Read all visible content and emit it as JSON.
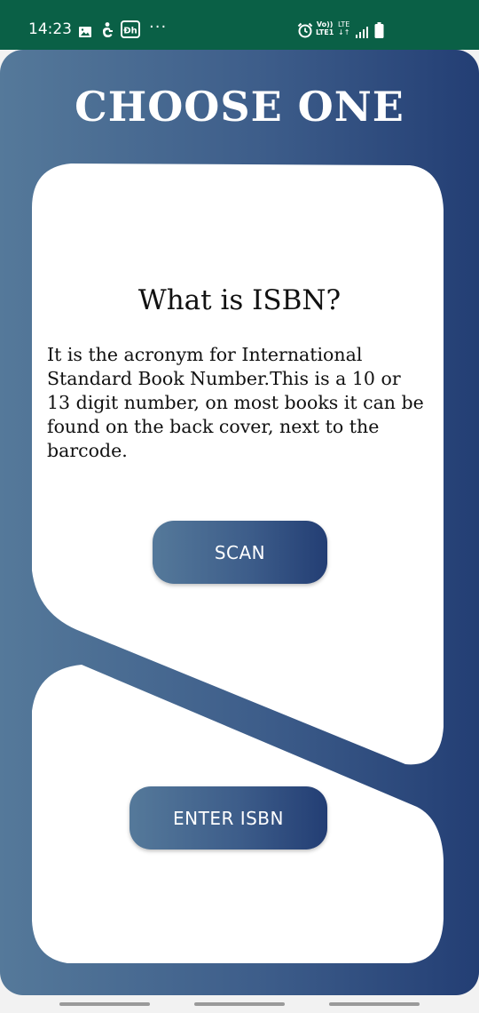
{
  "status_bar": {
    "time": "14:23",
    "overflow": "···",
    "network_line1": "Vo))",
    "network_line2": "LTE1",
    "lte_line1": "LTE",
    "lte_line2": "↓↑",
    "icons": [
      "image-icon",
      "accessibility-icon",
      "app-dh-icon",
      "alarm-icon",
      "signal-icon",
      "battery-icon"
    ],
    "background": "#0a6046"
  },
  "screen": {
    "title": "CHOOSE ONE",
    "gradient": [
      "#55799a",
      "#3d5d8a",
      "#233e74"
    ]
  },
  "isbn_info": {
    "heading": "What is ISBN?",
    "body": "It is the acronym for International Standard Book Number.This is a 10 or 13 digit number, on most books it can be found on the back cover, next to the barcode."
  },
  "actions": {
    "scan_label": "SCAN",
    "enter_label": "ENTER ISBN"
  }
}
